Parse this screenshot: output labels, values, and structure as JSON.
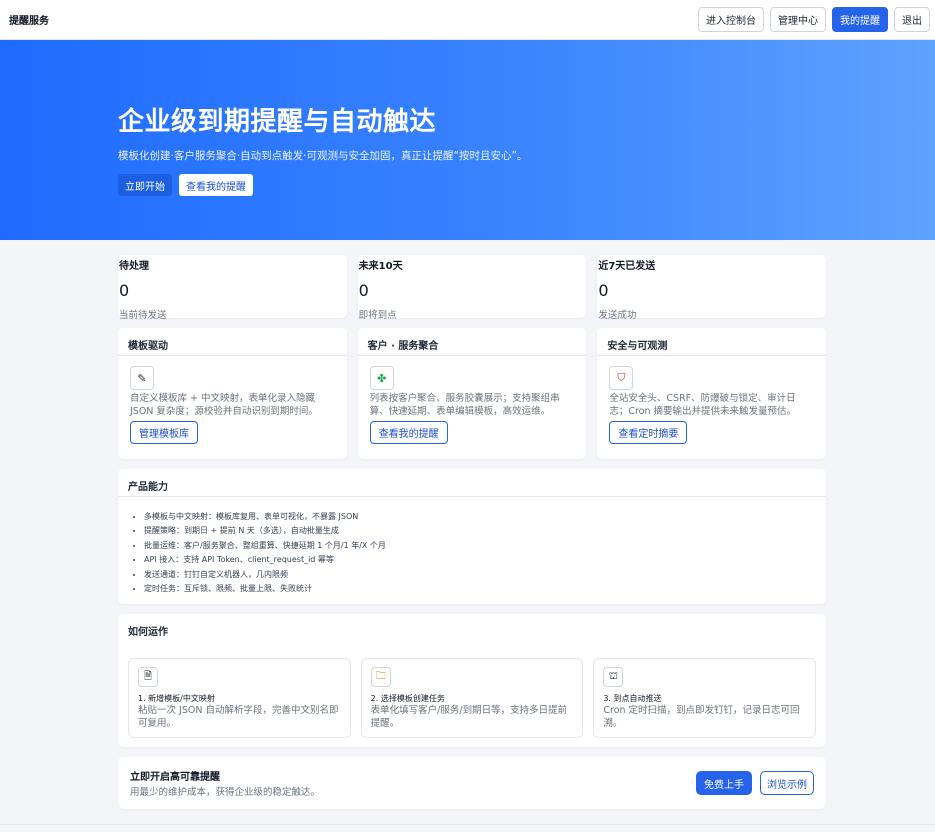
{
  "header": {
    "brand": "提醒服务",
    "actions": [
      "进入控制台",
      "管理中心",
      "我的提醒",
      "退出"
    ]
  },
  "hero": {
    "title": "企业级到期提醒与自动触达",
    "subtitle": "模板化创建·客户服务聚合·自动到点触发·可观测与安全加固，真正让提醒“按时且安心”。",
    "primary_btn": "立即开始",
    "secondary_btn": "查看我的提醒"
  },
  "stats": [
    {
      "title": "待处理",
      "value": "0",
      "desc": "当前待发送"
    },
    {
      "title": "未来10天",
      "value": "0",
      "desc": "即将到点"
    },
    {
      "title": "近7天已发送",
      "value": "0",
      "desc": "发送成功"
    }
  ],
  "features": [
    {
      "title": "模板驱动",
      "icon": "pencil-icon",
      "glyph": "✎",
      "desc": "自定义模板库 + 中文映射，表单化录入隐藏 JSON 复杂度；源校验并自动识别到期时间。",
      "button": "管理模板库"
    },
    {
      "title": "客户 · 服务聚合",
      "icon": "puzzle-icon",
      "glyph": "✤",
      "desc": "列表按客户聚合、服务胶囊展示；支持聚组串算、快速延期、表单编辑模板，高效运维。",
      "button": "查看我的提醒"
    },
    {
      "title": "安全与可观测",
      "icon": "shield-icon",
      "glyph": "⛉",
      "desc": "全站安全头、CSRF、防爆破与锁定、审计日志；Cron 摘要输出并提供未来触发量预估。",
      "button": "查看定时摘要"
    }
  ],
  "capabilities": {
    "title": "产品能力",
    "items": [
      "多模板与中文映射：模板库复用、表单可视化，不暴露 JSON",
      "提醒策略：到期日 + 提前 N 天（多选），自动批量生成",
      "批量运维：客户/服务聚合、整组重算、快捷延期 1 个月/1 年/X 个月",
      "API 接入：支持 API Token、client_request_id 幂等",
      "发送通道：钉钉自定义机器人，几内限频",
      "定时任务：互斥锁、限频、批量上限、失败统计"
    ]
  },
  "how": {
    "title": "如何运作",
    "steps": [
      {
        "icon": "document-icon",
        "glyph": "🗎",
        "title": "1. 新增模板/中文映射",
        "desc": "粘贴一次 JSON 自动解析字段，完善中文别名即可复用。"
      },
      {
        "icon": "folder-icon",
        "glyph": "🗀",
        "title": "2. 选择模板创建任务",
        "desc": "表单化填写客户/服务/到期日等，支持多日提前提醒。"
      },
      {
        "icon": "briefcase-icon",
        "glyph": "⛫",
        "title": "3. 到点自动推送",
        "desc": "Cron 定时扫描，到点即发钉钉，记录日志可回溯。"
      }
    ]
  },
  "cta": {
    "title": "立即开启高可靠提醒",
    "subtitle": "用最少的维护成本，获得企业级的稳定触达。",
    "primary": "免费上手",
    "secondary": "浏览示例"
  }
}
